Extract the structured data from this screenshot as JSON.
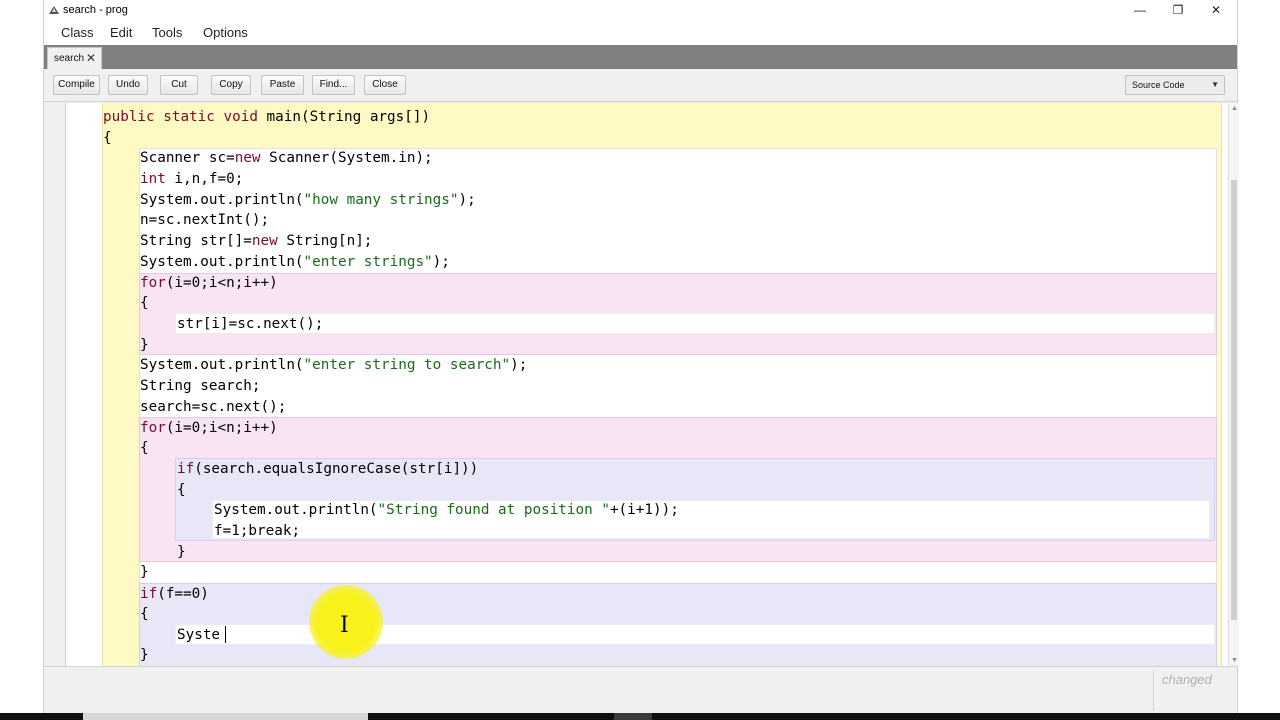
{
  "window": {
    "title": "search - prog",
    "minimize": "—",
    "maximize": "❐",
    "close": "✕"
  },
  "menu": [
    "Class",
    "Edit",
    "Tools",
    "Options"
  ],
  "tab": {
    "label": "search",
    "close": "✕"
  },
  "toolbar": {
    "compile": "Compile",
    "undo": "Undo",
    "cut": "Cut",
    "copy": "Copy",
    "paste": "Paste",
    "find": "Find...",
    "close": "Close"
  },
  "view_selector": {
    "selected": "Source Code"
  },
  "code": {
    "l1": [
      "public static void",
      " main(String args[])"
    ],
    "l2": "{",
    "l3": [
      "Scanner sc=",
      "new",
      " Scanner(System.in);"
    ],
    "l4": [
      "int",
      " i,n,f=0;"
    ],
    "l5": [
      "System.out.println(",
      "\"how many strings\"",
      ");"
    ],
    "l6": "n=sc.nextInt();",
    "l7": [
      "String str[]=",
      "new",
      " String[n];"
    ],
    "l8": [
      "System.out.println(",
      "\"enter strings\"",
      ");"
    ],
    "l9": [
      "for",
      "(i=0;i<n;i++)"
    ],
    "l10": "{",
    "l11": "str[i]=sc.next();",
    "l12": "}",
    "l13": [
      "System.out.println(",
      "\"enter string to search\"",
      ");"
    ],
    "l14": "String search;",
    "l15": "search=sc.next();",
    "l16": [
      "for",
      "(i=0;i<n;i++)"
    ],
    "l17": "{",
    "l18": [
      "if",
      "(search.equalsIgnoreCase(str[i]))"
    ],
    "l19": "{",
    "l20": [
      "System.out.println(",
      "\"String found at position \"",
      "+(i+1));"
    ],
    "l21": "f=1;break;",
    "l22": "}",
    "l23": "}",
    "l24": [
      "if",
      "(f==0)"
    ],
    "l25": "{",
    "l26": "Syste",
    "l27": "}"
  },
  "status": {
    "changed": "changed"
  },
  "colors": {
    "keyword": "#7a0b2b",
    "string": "#1a6b1a",
    "class_scope": "#fff9c4",
    "loop_scope": "#f8e4f4",
    "if_scope": "#e8e7f8"
  }
}
